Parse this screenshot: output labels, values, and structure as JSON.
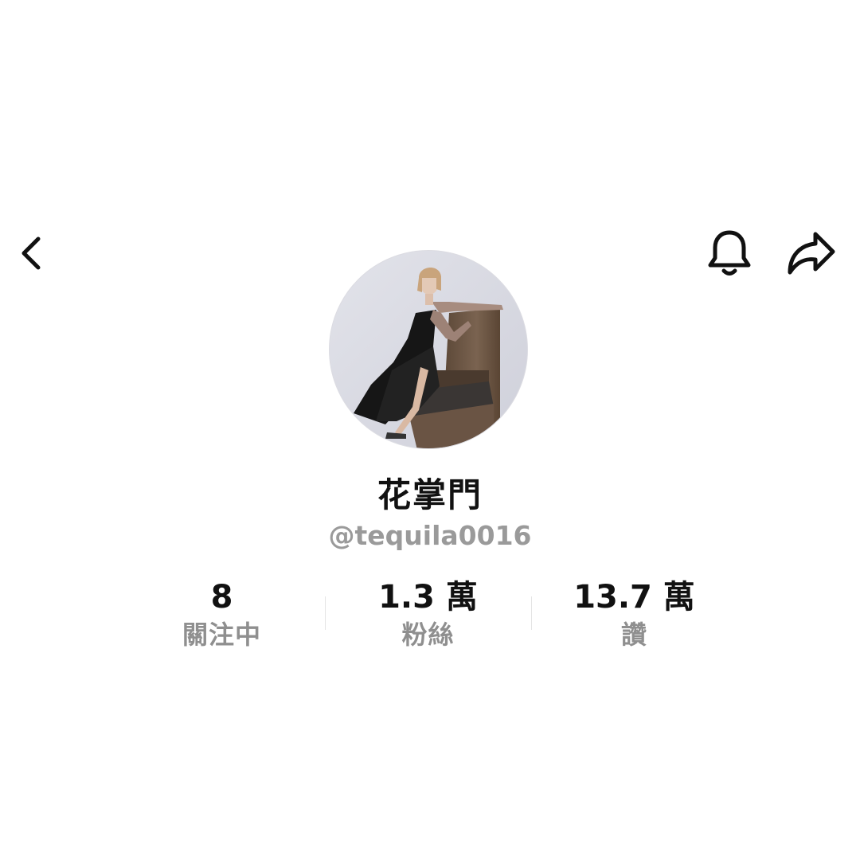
{
  "header": {
    "back_icon": "chevron-left-icon",
    "notification_icon": "bell-icon",
    "share_icon": "share-arrow-icon"
  },
  "profile": {
    "display_name": "花掌門",
    "handle": "@tequila0016"
  },
  "stats": [
    {
      "value": "8",
      "label": "關注中"
    },
    {
      "value": "1.3 萬",
      "label": "粉絲"
    },
    {
      "value": "13.7 萬",
      "label": "讚"
    }
  ]
}
